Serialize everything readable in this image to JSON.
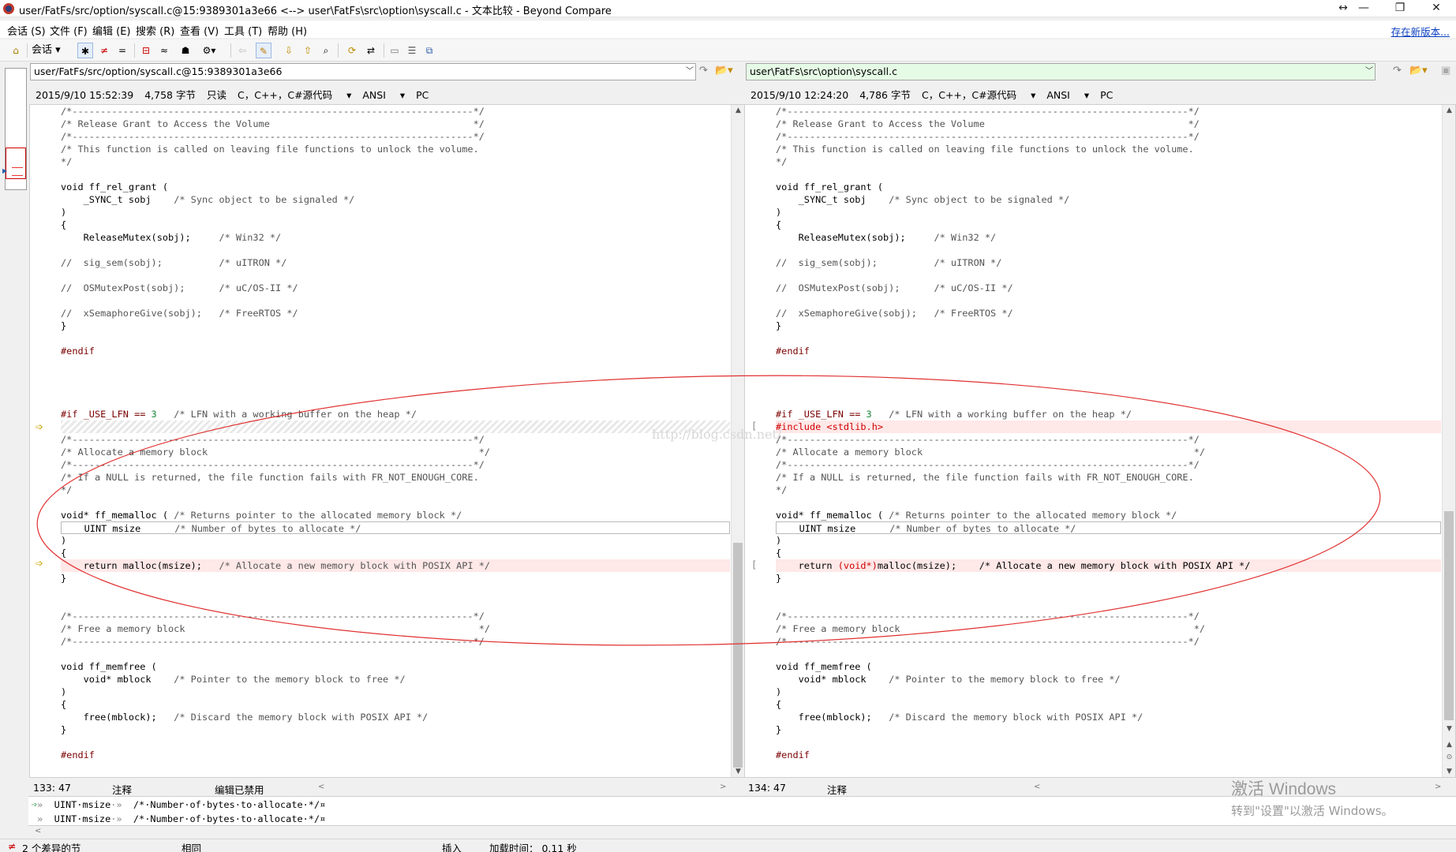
{
  "window": {
    "title": "user/FatFs/src/option/syscall.c@15:9389301a3e66 <--> user\\FatFs\\src\\option\\syscall.c - 文本比较 - Beyond Compare",
    "buttons": [
      "↔",
      "—",
      "❐",
      "✕"
    ]
  },
  "menubar": {
    "items": [
      "会话 (S)",
      "文件 (F)",
      "编辑 (E)",
      "搜索 (R)",
      "查看 (V)",
      "工具 (T)",
      "帮助 (H)"
    ],
    "new_version": "存在新版本..."
  },
  "toolbar": {
    "session_label": "会话",
    "icons": [
      "home-icon",
      "show-all-icon",
      "show-diffs-icon",
      "show-same-icon",
      "filter-icon",
      "approx-icon",
      "rules-icon",
      "format-icon",
      "back-icon",
      "edit-icon",
      "next-diff-icon",
      "prev-diff-icon",
      "find-icon",
      "swap-icon",
      "refresh-icon",
      "expand-icon",
      "collapse-icon",
      "copy-icon"
    ]
  },
  "left": {
    "path": "user/FatFs/src/option/syscall.c@15:9389301a3e66",
    "info": {
      "date": "2015/9/10 15:52:39",
      "size": "4,758 字节",
      "readonly": "只读",
      "format": "C，C++，C#源代码",
      "encoding": "ANSI",
      "lineend": "PC"
    },
    "status": {
      "pos": "133: 47",
      "type": "注释",
      "edit": "编辑已禁用"
    }
  },
  "right": {
    "path": "user\\FatFs\\src\\option\\syscall.c",
    "info": {
      "date": "2015/9/10 12:24:20",
      "size": "4,786 字节",
      "format": "C，C++，C#源代码",
      "encoding": "ANSI",
      "lineend": "PC"
    },
    "status": {
      "pos": "134: 47",
      "type": "注释"
    }
  },
  "code": {
    "sep": "/*-----------------------------------------------------------------------*/",
    "release_title": "/* Release Grant to Access the Volume                                    */",
    "release_desc": "/* This function is called on leaving file functions to unlock the volume.",
    "close": "*/",
    "fn_rel": "void ff_rel_grant (",
    "param_sobj": "    _SYNC_t sobj    ",
    "param_sobj_c": "/* Sync object to be signaled */",
    "paren_close": ")",
    "brace_open": "{",
    "brace_close": "}",
    "rel_mutex": "    ReleaseMutex(sobj);     ",
    "rel_mutex_c": "/* Win32 */",
    "sig_sem": "//  sig_sem(sobj);          ",
    "sig_sem_c": "/* uITRON */",
    "os_post": "//  OSMutexPost(sobj);      ",
    "os_post_c": "/* uC/OS-II */",
    "x_give": "//  xSemaphoreGive(sobj);   ",
    "x_give_c": "/* FreeRTOS */",
    "endif": "#endif",
    "if_lfn": "#if _USE_LFN == ",
    "if_lfn_num": "3",
    "if_lfn_c": "   /* LFN with a working buffer on the heap */",
    "include": "#include <stdlib.h>",
    "alloc_title": "/* Allocate a memory block                                                */",
    "alloc_desc": "/* If a NULL is returned, the file function fails with FR_NOT_ENOUGH_CORE.",
    "fn_malloc": "void* ff_memalloc ( ",
    "fn_malloc_c": "/* Returns pointer to the allocated memory block */",
    "param_msize": "    UINT msize      ",
    "param_msize_c": "/* Number of bytes to allocate */",
    "ret_left": "    return malloc(msize);   ",
    "ret_right_a": "    return ",
    "ret_right_cast": "(void*)",
    "ret_right_b": "malloc(msize);    ",
    "ret_c": "/* Allocate a new memory block with POSIX API */",
    "free_title": "/* Free a memory block                                                    */",
    "fn_free": "void ff_memfree (",
    "param_mblock": "    void* mblock    ",
    "param_mblock_c": "/* Pointer to the memory block to free */",
    "free_call": "    free(mblock);   ",
    "free_call_c": "/* Discard the memory block with POSIX API */"
  },
  "detail": {
    "line1": "UINT·msize",
    "line1_c": "/*·Number·of·bytes·to·allocate·*/¤",
    "line2": "UINT·msize",
    "line2_c": "/*·Number·of·bytes·to·allocate·*/¤"
  },
  "statusbar": {
    "diff_count": "2 个差异的节",
    "same": "相同",
    "insert": "插入",
    "load_time": "加载时间： 0.11 秒"
  },
  "watermark": {
    "line1": "激活 Windows",
    "line2": "转到\"设置\"以激活 Windows。"
  },
  "blog_watermark": "http://blog.csdn.net/"
}
